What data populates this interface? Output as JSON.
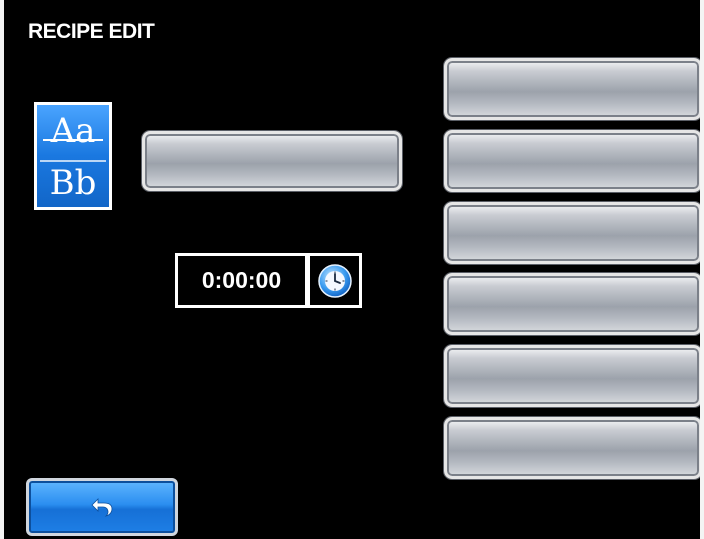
{
  "screen": {
    "title": "RECIPE EDIT"
  },
  "font_button": {
    "icon": "font-style-icon",
    "line1": "Aa",
    "line2": "Bb"
  },
  "name_field": {
    "value": ""
  },
  "timer": {
    "value": "0:00:00",
    "icon": "clock-icon"
  },
  "right_buttons": [
    {
      "label": ""
    },
    {
      "label": ""
    },
    {
      "label": ""
    },
    {
      "label": ""
    },
    {
      "label": ""
    },
    {
      "label": ""
    }
  ],
  "back_button": {
    "icon": "back-arrow-icon"
  },
  "colors": {
    "background": "#000000",
    "accent_blue": "#1a78e0",
    "silver": "#b3b8c0",
    "text": "#ffffff"
  }
}
